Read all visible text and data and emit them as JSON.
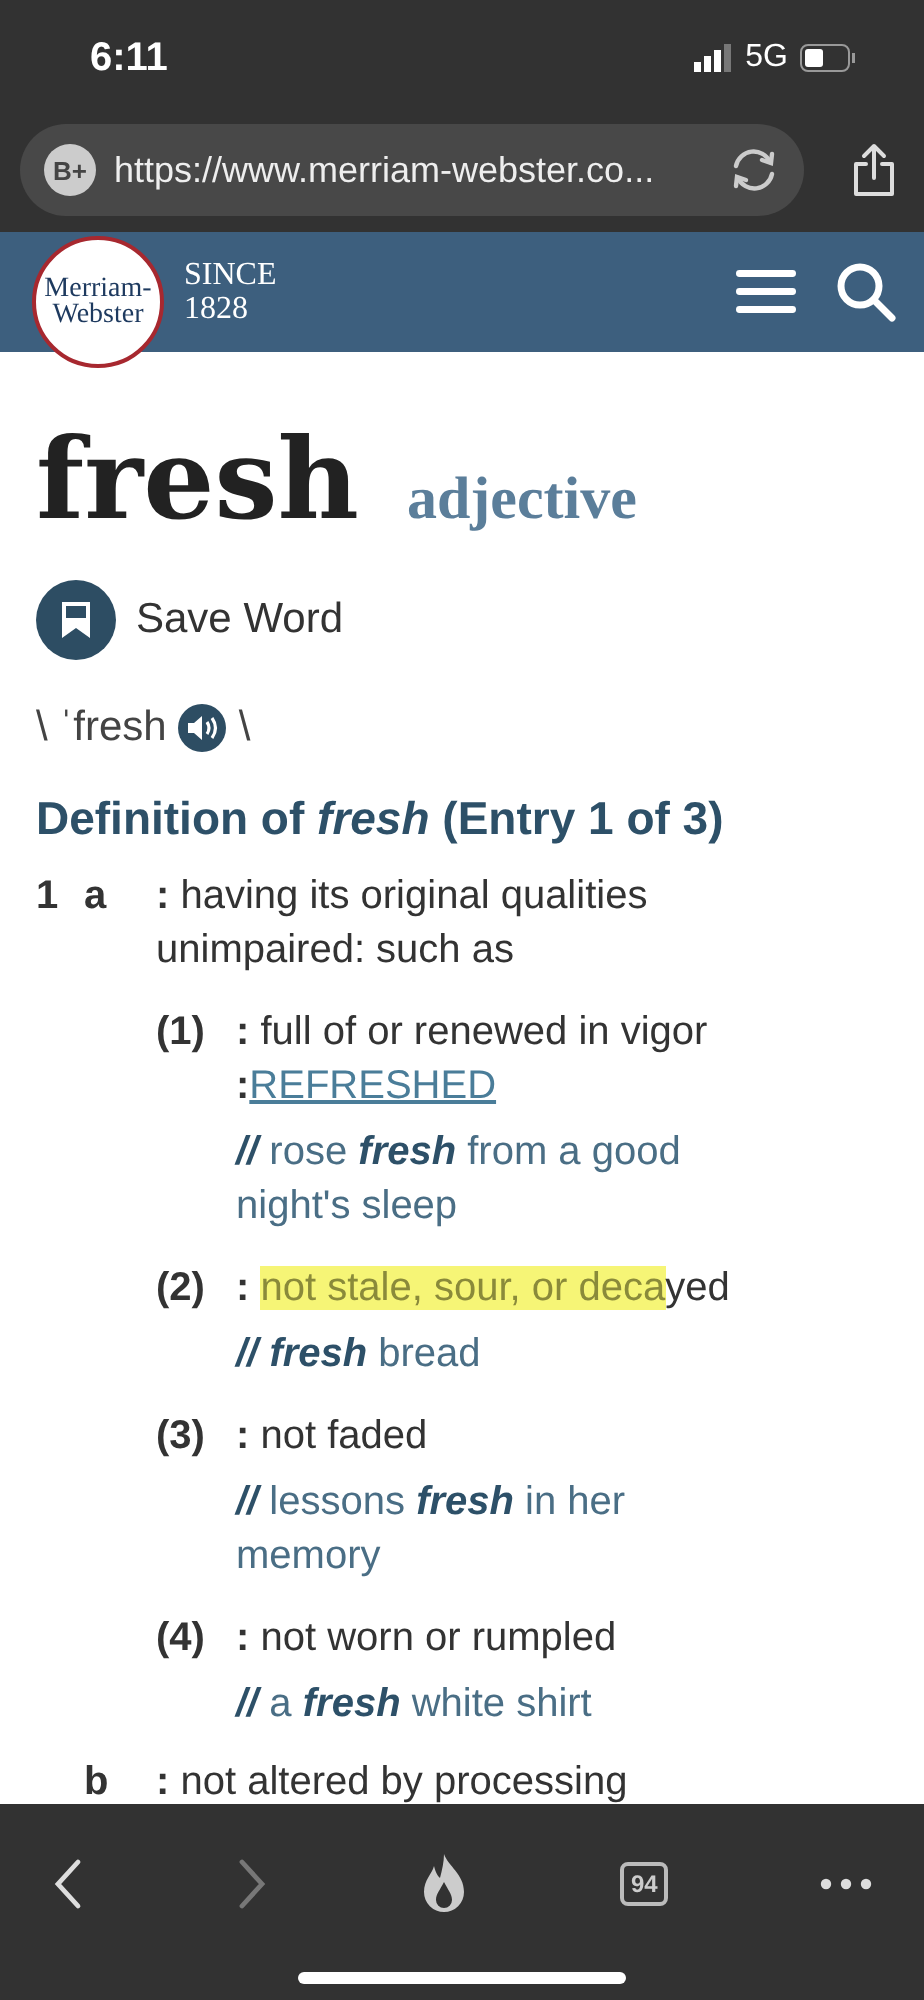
{
  "status_bar": {
    "time": "6:11",
    "network": "5G"
  },
  "browser": {
    "badge": "B+",
    "url": "https://www.merriam-webster.co..."
  },
  "site_header": {
    "logo": [
      "Merriam-",
      "Webster"
    ],
    "since": [
      "SINCE",
      "1828"
    ]
  },
  "entry": {
    "headword": "fresh",
    "part_of_speech": "adjective",
    "save_label": "Save Word",
    "pron_open": "\\ ˈfresh",
    "pron_close": "\\",
    "heading": "Definition of *fresh* (Entry 1 of 3)",
    "senses": [
      {
        "number": "1",
        "letter": "a",
        "definition": "**:** having its original qualities unimpaired: such as",
        "subsenses": [
          {
            "label": "(1)",
            "parts": [
              {
                "text": "**:** full of or renewed in vigor **:**",
                "highlighted": false
              }
            ],
            "link": "REFRESHED",
            "example": "**//** rose **fresh** from a good night's sleep"
          },
          {
            "label": "(2)",
            "parts": [
              {
                "text": "**:** ",
                "highlighted": false
              },
              {
                "text": "not stale, sour, or deca",
                "highlighted": true
              },
              {
                "text": "yed",
                "highlighted": false
              }
            ],
            "example": "**//** **fresh** bread"
          },
          {
            "label": "(3)",
            "parts": [
              {
                "text": "**:** not faded",
                "highlighted": false
              }
            ],
            "example": "**//** lessons **fresh** in her memory"
          },
          {
            "label": "(4)",
            "parts": [
              {
                "text": "**:** not worn or rumpled",
                "highlighted": false
              }
            ],
            "example": "**//** a **fresh** white shirt"
          }
        ]
      },
      {
        "letter": "b",
        "definition": "**:** not altered by processing"
      }
    ]
  },
  "toolbar": {
    "back_disabled": false,
    "forward_disabled": true,
    "tab_count": "94"
  }
}
